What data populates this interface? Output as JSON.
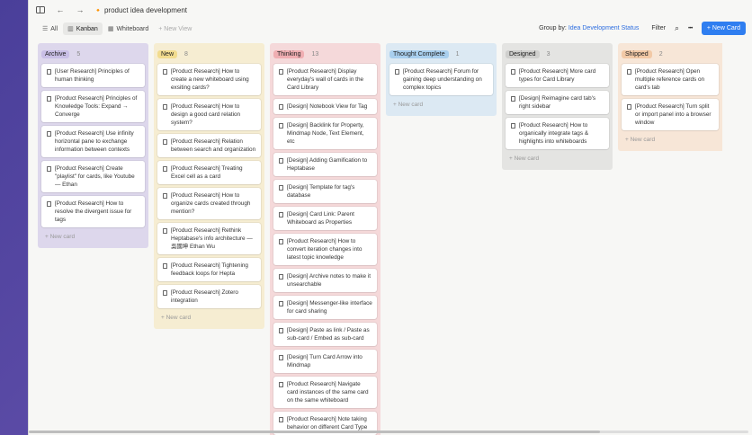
{
  "app": {
    "title": "product idea development",
    "title_icon": "🔸"
  },
  "toolbar": {
    "tabs": [
      {
        "label": "All",
        "icon": "list-icon",
        "active": false
      },
      {
        "label": "Kanban",
        "icon": "kanban-icon",
        "active": true
      },
      {
        "label": "Whiteboard",
        "icon": "whiteboard-icon",
        "active": false
      }
    ],
    "new_view": "+ New View",
    "group_by_label": "Group by:",
    "group_by_value": "Idea Development Status",
    "filter": "Filter",
    "more": "•••",
    "new_card": "+ New Card"
  },
  "colors": {
    "accent": "#2f7ef0",
    "archive": "#ddd7ec",
    "new": "#f6edd2",
    "thinking": "#f5d9da",
    "thought_complete": "#dce9f3",
    "designed": "#e4e4e2",
    "shipped": "#f7e6d7"
  },
  "columns": [
    {
      "name": "Archive",
      "count": "5",
      "cards": [
        "[User Research] Principles of human thinking",
        "[Product Research] Principles of Knowledge Tools: Expand → Converge",
        "[Product Research] Use infinity horizontal pane to exchange information between contexts",
        "[Product Research] Create \"playlist\" for cards, like Youtube — Ethan",
        "[Product Research] How to resolve the divergent issue for tags"
      ],
      "new_card": "+ New card"
    },
    {
      "name": "New",
      "count": "8",
      "cards": [
        "[Product Research] How to create a new whiteboard using exsiting cards?",
        "[Product Research] How to design a good card relation system?",
        "[Product Research] Relation between search and organization",
        "[Product Research] Treating Excel cell as a card",
        "[Product Research] How to organize cards created through mention?",
        "[Product Research] Rethink Heptabase's info architecture — 吳國坤 Ethan Wu",
        "[Product Research] Tightening feedback loops for Hepta",
        "[Product Research] Zotero integration"
      ],
      "new_card": "+ New card"
    },
    {
      "name": "Thinking",
      "count": "13",
      "cards": [
        "[Product Research] Display everyday's wall of cards in the Card Library",
        "[Design] Notebook View for Tag",
        "[Design] Backlink for Property, Mindmap Node, Text Element, etc",
        "[Design] Adding Gamification to Heptabase",
        "[Design] Template for tag's database",
        "[Design] Card Link: Parent Whiteboard as Properties",
        "[Product Research] How to convert iteration changes into latest topic knowledge",
        "[Design] Archive notes to make it unsearchable",
        "[Design] Messenger-like interface for card sharing",
        "[Design] Paste as link / Paste as sub-card / Embed as sub-card",
        "[Design] Turn Card Arrow into Mindmap",
        "[Product Research] Navigate card instances of the same card on the same whiteboard",
        "[Product Research] Note taking behavior on different Card Type"
      ],
      "new_card": ""
    },
    {
      "name": "Thought Complete",
      "count": "1",
      "cards": [
        "[Product Research] Forum for gaining deep understanding on complex topics"
      ],
      "new_card": "+ New card"
    },
    {
      "name": "Designed",
      "count": "3",
      "cards": [
        "[Product Research] More card types for Card Library",
        "[Design] Reimagine card tab's right sidebar",
        "[Product Research] How to organically integrate tags & highlights into whiteboards"
      ],
      "new_card": "+ New card"
    },
    {
      "name": "Shipped",
      "count": "2",
      "cards": [
        "[Product Research] Open multiple reference cards on card's tab",
        "[Product Research] Turn split or import panel into a browser window"
      ],
      "new_card": "+ New card"
    }
  ]
}
